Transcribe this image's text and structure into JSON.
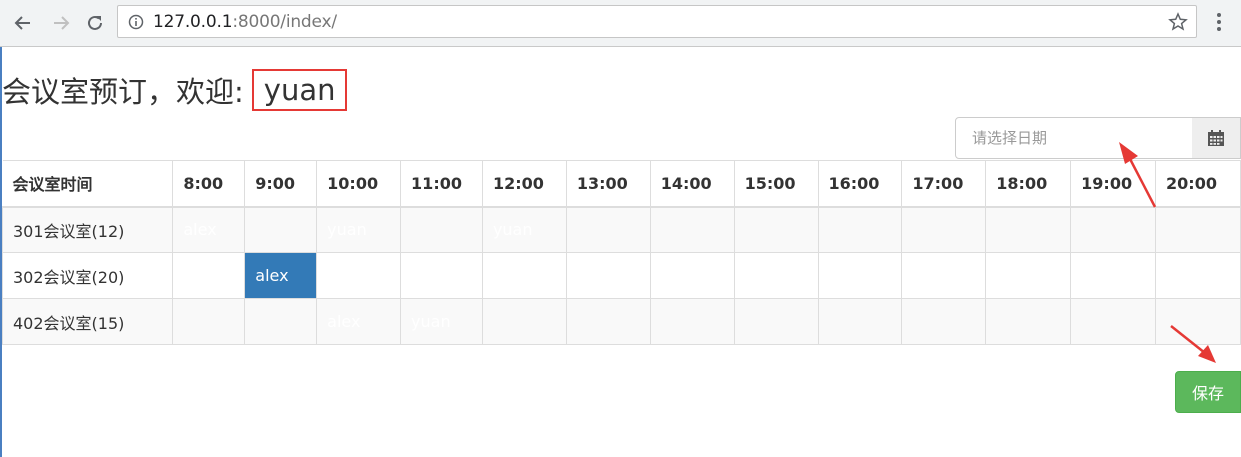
{
  "browser": {
    "url_host": "127.0.0.1",
    "url_path": ":8000/index/"
  },
  "page": {
    "heading": "会议室预订，欢迎:",
    "username": "yuan",
    "date_placeholder": "请选择日期",
    "save_label": "保存"
  },
  "table": {
    "corner_header": "会议室时间",
    "time_headers": [
      "8:00",
      "9:00",
      "10:00",
      "11:00",
      "12:00",
      "13:00",
      "14:00",
      "15:00",
      "16:00",
      "17:00",
      "18:00",
      "19:00",
      "20:00"
    ],
    "rows": [
      {
        "room": "301会议室(12)",
        "cells": [
          "alex",
          "",
          "yuan",
          "",
          "yuan",
          "",
          "",
          "",
          "",
          "",
          "",
          "",
          ""
        ]
      },
      {
        "room": "302会议室(20)",
        "cells": [
          "",
          "alex",
          "",
          "",
          "",
          "",
          "",
          "",
          "",
          "",
          "",
          "",
          ""
        ]
      },
      {
        "room": "402会议室(15)",
        "cells": [
          "",
          "",
          "alex",
          "yuan",
          "",
          "",
          "",
          "",
          "",
          "",
          "",
          "",
          ""
        ]
      }
    ]
  },
  "colors": {
    "alex_booking": "#337ab7",
    "yuan_booking": "#008000",
    "save_button": "#5cb85c",
    "annotation": "#e53935"
  },
  "icons": {
    "back": "arrow-left-icon",
    "forward": "arrow-right-icon",
    "reload": "reload-icon",
    "info": "info-icon",
    "bookmark": "star-icon",
    "menu": "kebab-menu-icon",
    "calendar": "calendar-icon"
  }
}
